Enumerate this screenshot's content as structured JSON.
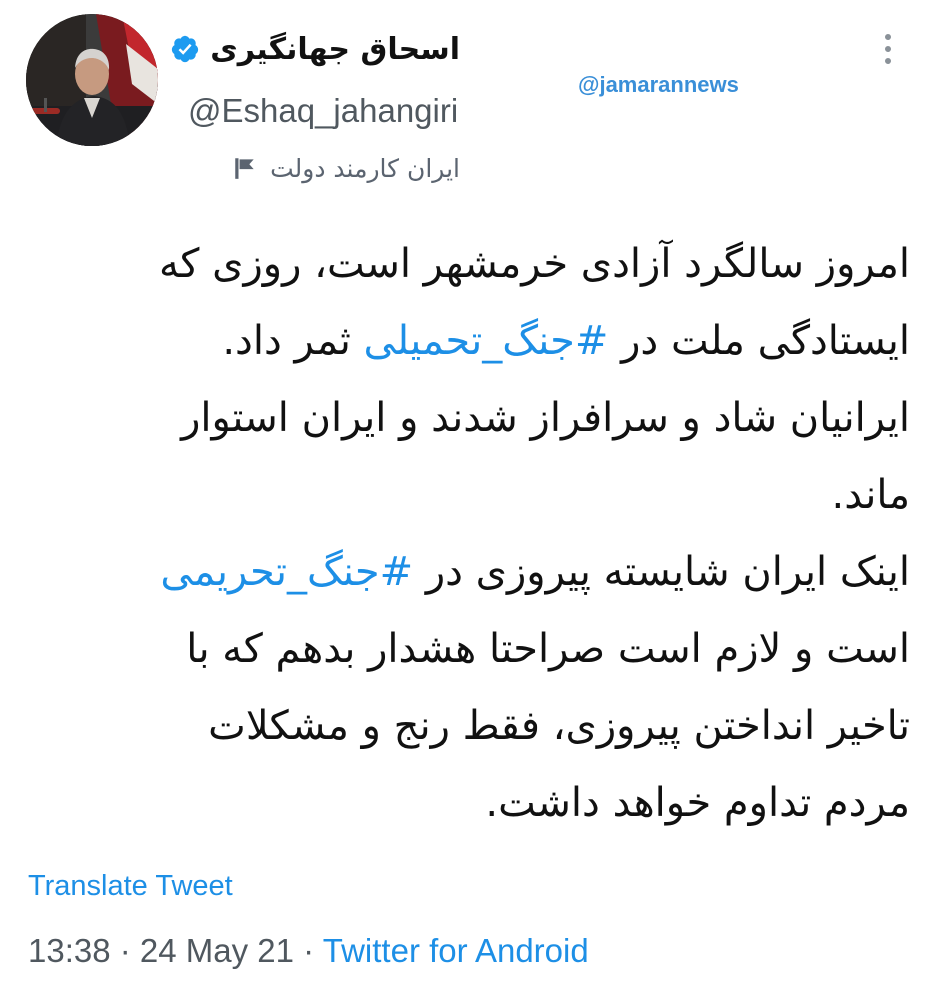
{
  "author": {
    "display_name": "اسحاق جهانگیری",
    "handle": "@Eshaq_jahangiri",
    "verified": true,
    "label": "ایران کارمند دولت",
    "verified_color": "#1d9bf0"
  },
  "watermark": "@jamarannews",
  "tweet": {
    "lines": [
      {
        "pre": "امروز سالگرد آزادی خرمشهر است، روزی که",
        "tag": "",
        "post": ""
      },
      {
        "pre": "ایستادگی ملت در ",
        "tag": "#جنگ_تحمیلی",
        "post": " ثمر داد."
      },
      {
        "pre": "ایرانیان شاد و سرافراز شدند و ایران استوار",
        "tag": "",
        "post": ""
      },
      {
        "pre": "ماند.",
        "tag": "",
        "post": ""
      },
      {
        "pre": "اینک ایران شایسته پیروزی در ",
        "tag": "#جنگ_تحریمی",
        "post": ""
      },
      {
        "pre": "است و لازم است صراحتا هشدار بدهم که با",
        "tag": "",
        "post": ""
      },
      {
        "pre": "تاخیر انداختن پیروزی، فقط رنج و مشکلات",
        "tag": "",
        "post": ""
      },
      {
        "pre": "مردم تداوم خواهد داشت.",
        "tag": "",
        "post": ""
      }
    ],
    "hashtag_color": "#1d8fe6"
  },
  "translate_label": "Translate Tweet",
  "meta": {
    "time": "13:38",
    "sep1": " · ",
    "date": "24 May 21",
    "sep2": " · ",
    "source": "Twitter for Android"
  },
  "icons": {
    "more": "more-vertical-icon",
    "verified": "verified-badge-icon",
    "label": "flag-icon"
  }
}
